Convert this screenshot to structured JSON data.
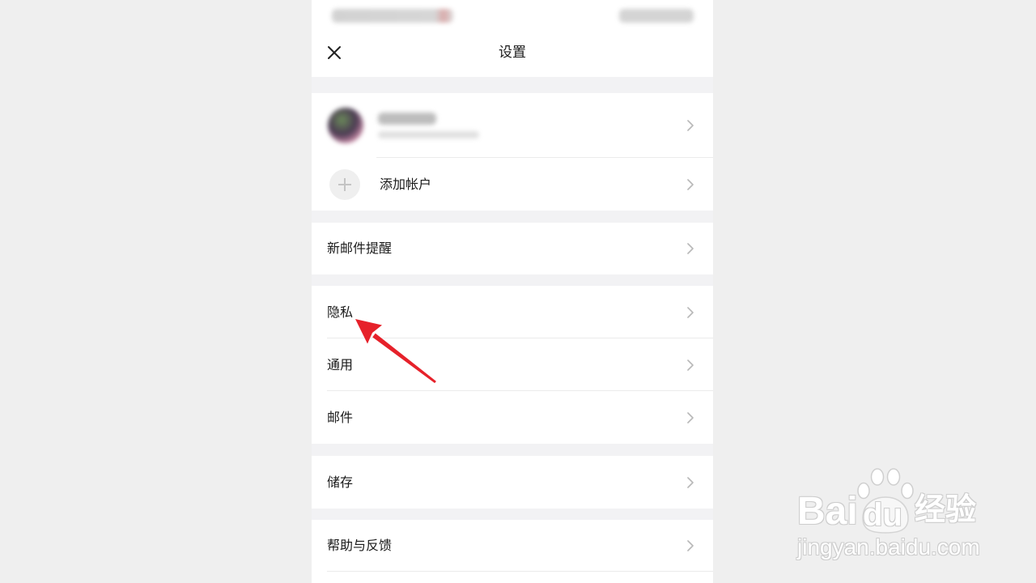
{
  "header": {
    "title": "设置",
    "close_icon": "close-icon"
  },
  "accounts": {
    "current": {
      "avatar_icon": "avatar",
      "chevron_icon": "chevron-right-icon"
    },
    "add_account": {
      "label": "添加帐户",
      "icon": "plus-icon",
      "chevron_icon": "chevron-right-icon"
    }
  },
  "settings_groups": [
    {
      "items": [
        {
          "label": "新邮件提醒",
          "chevron_icon": "chevron-right-icon"
        }
      ]
    },
    {
      "items": [
        {
          "label": "隐私",
          "chevron_icon": "chevron-right-icon"
        },
        {
          "label": "通用",
          "chevron_icon": "chevron-right-icon"
        },
        {
          "label": "邮件",
          "chevron_icon": "chevron-right-icon"
        }
      ]
    },
    {
      "items": [
        {
          "label": "储存",
          "chevron_icon": "chevron-right-icon"
        }
      ]
    },
    {
      "items": [
        {
          "label": "帮助与反馈",
          "chevron_icon": "chevron-right-icon"
        }
      ]
    }
  ],
  "annotation": {
    "icon": "red-arrow-icon",
    "color": "#e6212a"
  },
  "watermark": {
    "logo_left": "Bai",
    "logo_paw": "du",
    "logo_right": "经验",
    "url": "jingyan.baidu.com",
    "paw_icon": "paw-icon"
  },
  "colors": {
    "page_background": "#efefef",
    "group_gap": "#f2f2f4",
    "panel": "#ffffff",
    "text": "#1a1a1a",
    "divider": "#ebebeb",
    "chevron": "#b8b8b8",
    "plus_circle": "#efefef",
    "arrow": "#e6212a"
  }
}
